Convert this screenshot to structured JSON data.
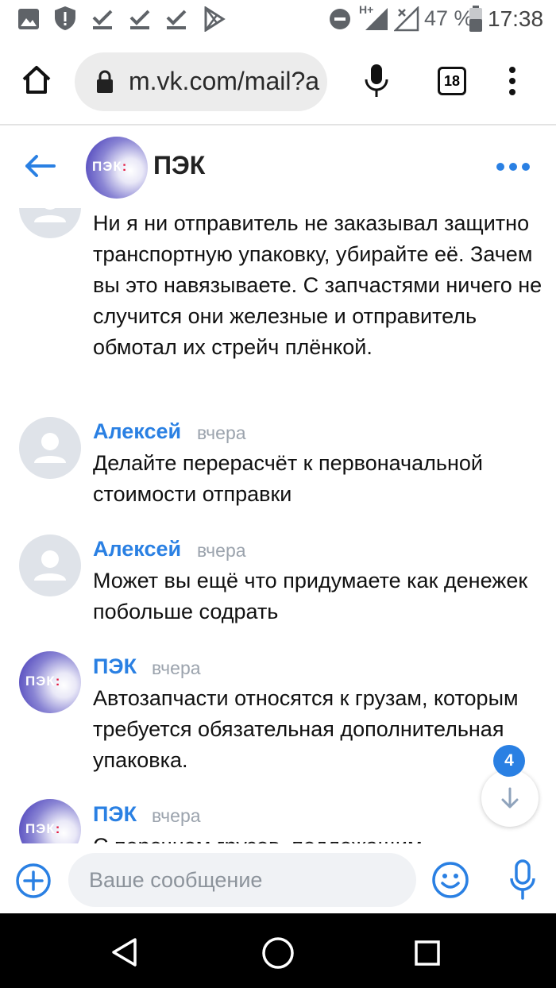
{
  "status_bar": {
    "battery_percent": "47 %",
    "time": "17:38",
    "network_label": "H+"
  },
  "browser": {
    "url": "m.vk.com/mail?a",
    "tab_count": "18"
  },
  "chat": {
    "title": "ПЭК",
    "avatar_logo": "ПЭК",
    "messages": [
      {
        "author": "",
        "time": "",
        "text": "Ни я ни отправитель не заказывал защитно транспортную упаковку, убирайте её. Зачем вы это навязываете. С запчастями ничего не случится они железные и отправитель обмотал их стрейч плёнкой."
      },
      {
        "author": "Алексей",
        "time": "вчера",
        "text": "Делайте перерасчёт к первоначальной стоимости отправки"
      },
      {
        "author": "Алексей",
        "time": "вчера",
        "text": "Может вы ещё что придумаете как денежек побольше содрать"
      },
      {
        "author": "ПЭК",
        "time": "вчера",
        "text": "Автозапчасти относятся к грузам, которым требуется обязательная дополнительная упаковка."
      },
      {
        "author": "ПЭК",
        "time": "вчера",
        "text": "С перечнем грузов, подлежащим"
      }
    ],
    "unread_badge": "4"
  },
  "composer": {
    "placeholder": "Ваше сообщение"
  },
  "colors": {
    "accent": "#2a80e3",
    "time_gray": "#9ba3ad",
    "pek_brand": "#3b2fb4",
    "pek_red": "#e3173e"
  },
  "icons": {
    "status_left": [
      "gallery-icon",
      "shield-icon",
      "download-done-icon",
      "download-done-icon",
      "download-done-icon",
      "play-store-icon"
    ],
    "status_right": [
      "do-not-disturb-icon",
      "signal-icon",
      "no-signal-icon",
      "battery-icon"
    ],
    "browser": [
      "home-icon",
      "lock-icon",
      "mic-icon",
      "tabs-icon",
      "more-vertical-icon"
    ],
    "header": [
      "back-arrow-icon",
      "more-horizontal-icon"
    ],
    "composer": [
      "add-icon",
      "emoji-icon",
      "mic-icon"
    ],
    "nav": [
      "back-triangle-icon",
      "home-circle-icon",
      "recents-square-icon"
    ]
  }
}
